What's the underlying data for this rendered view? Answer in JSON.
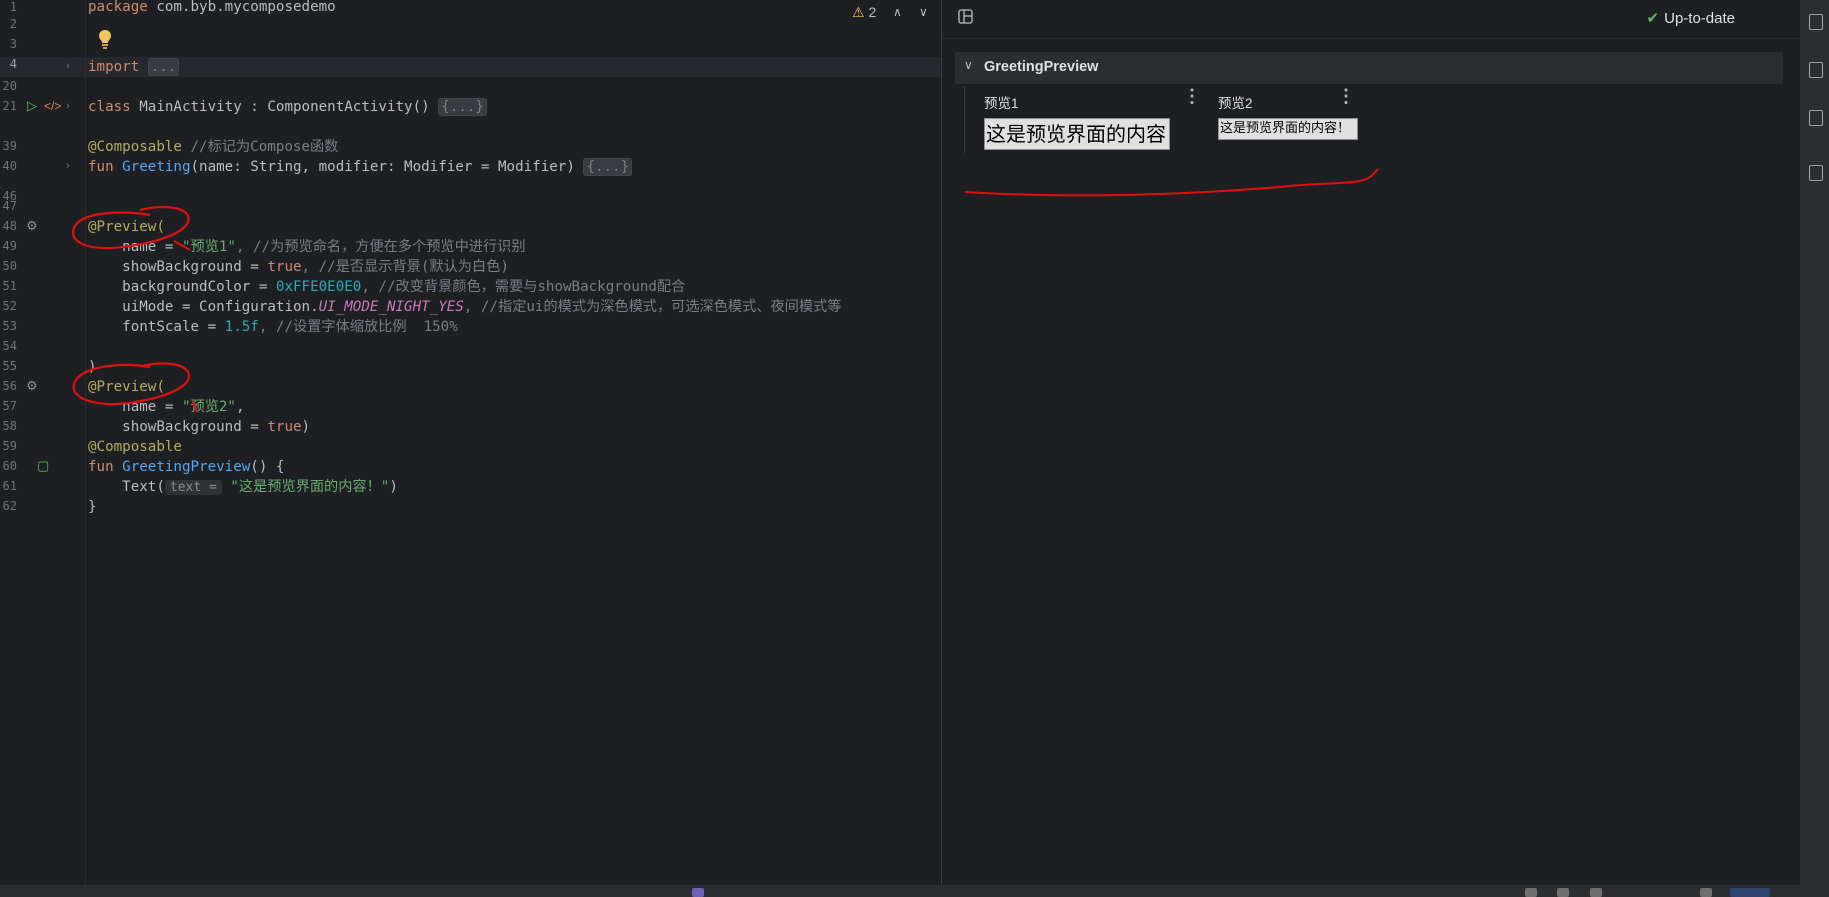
{
  "editor": {
    "lines": [
      {
        "num": "1",
        "top": 0
      },
      {
        "num": "2"
      },
      {
        "num": "3"
      },
      {
        "num": "4"
      },
      {
        "num": "20"
      },
      {
        "num": "21"
      },
      {
        "num": "39"
      },
      {
        "num": "40"
      },
      {
        "num": "46"
      },
      {
        "num": "47"
      },
      {
        "num": "48"
      },
      {
        "num": "49"
      },
      {
        "num": "50"
      },
      {
        "num": "51"
      },
      {
        "num": "52"
      },
      {
        "num": "53"
      },
      {
        "num": "54"
      },
      {
        "num": "55"
      },
      {
        "num": "56"
      },
      {
        "num": "57"
      },
      {
        "num": "58"
      },
      {
        "num": "59"
      },
      {
        "num": "60"
      },
      {
        "num": "61"
      },
      {
        "num": "62"
      }
    ],
    "code": {
      "l1_kw": "package",
      "l1_rest": " com.byb.mycomposedemo",
      "l4_kw": "import",
      "l4_fold": "...",
      "l21_kw": "class",
      "l21_rest": " MainActivity : ComponentActivity() ",
      "l21_fold": "{...}",
      "l39_ann": "@Composable",
      "l39_cmt": " //标记为Compose函数",
      "l40_kw": "fun",
      "l40_fn": "Greeting",
      "l40_rest": "(name: String, modifier: Modifier = Modifier) ",
      "l40_fold": "{...}",
      "l48_ann": "@Preview",
      "l48_rest": "(",
      "l49_a": "    name = ",
      "l49_str": "\"预览1\"",
      "l49_cmt": ", //为预览命名，方便在多个预览中进行识别",
      "l50_a": "    showBackground = ",
      "l50_kw": "true",
      "l50_cmt": ", //是否显示背景(默认为白色)",
      "l51_a": "    backgroundColor = ",
      "l51_num": "0xFFE0E0E0",
      "l51_cmt": ", //改变背景颜色，需要与showBackground配合",
      "l52_a": "    uiMode = Configuration.",
      "l52_const": "UI_MODE_NIGHT_YES",
      "l52_cmt": ", //指定ui的模式为深色模式，可选深色模式、夜间模式等",
      "l53_a": "    fontScale = ",
      "l53_num": "1.5f",
      "l53_cmt": ", //设置字体缩放比例  150%",
      "l55": ")",
      "l56_ann": "@Preview",
      "l56_rest": "(",
      "l57_a": "    name = ",
      "l57_str": "\"预览2\"",
      "l57_rest": ",",
      "l58_a": "    showBackground = ",
      "l58_kw": "true",
      "l58_rest": ")",
      "l59_ann": "@Composable",
      "l60_kw": "fun",
      "l60_fn": "GreetingPreview",
      "l60_rest": "() {",
      "l61_a": "    Text(",
      "l61_hint": "text =",
      "l61_str": "\"这是预览界面的内容！\"",
      "l61_rest": ")",
      "l62": "}"
    },
    "warnings_count": "2"
  },
  "preview": {
    "status": "Up-to-date",
    "group_title": "GreetingPreview",
    "items": [
      {
        "label": "预览1",
        "content": "这是预览界面的内容！"
      },
      {
        "label": "预览2",
        "content": "这是预览界面的内容！"
      }
    ]
  },
  "colors": {
    "background": "#1e1f22",
    "keyword": "#cf8e6d",
    "annotation": "#b3ae60",
    "function": "#56a8f5",
    "string": "#6aab73",
    "number": "#2aacb8",
    "comment": "#7a7e85",
    "annotation_ink": "#e01010"
  },
  "icons": {
    "warning": "warning-triangle-icon",
    "bulb": "lightbulb-icon",
    "run": "run-gutter-icon",
    "gear": "preview-gear-icon",
    "check": "check-icon"
  }
}
